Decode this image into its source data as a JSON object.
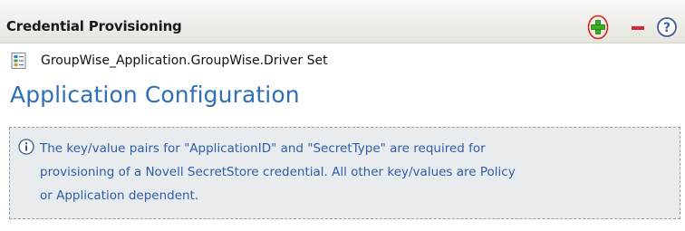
{
  "header": {
    "title": "Credential Provisioning",
    "icons": [
      "add-icon",
      "remove-icon",
      "help-icon"
    ],
    "accent_color": "#1f9a1f",
    "remove_color": "#d9263a",
    "highlight_color": "#e0201a"
  },
  "object": {
    "icon": "driver-set-icon",
    "label": "GroupWise_Application.GroupWise.Driver Set"
  },
  "section": {
    "title": "Application Configuration",
    "title_color": "#2f6fb6"
  },
  "info": {
    "icon": "info-icon",
    "lines": [
      "The key/value pairs for \"ApplicationID\" and \"SecretType\" are required for",
      "provisioning of a Novell SecretStore credential. All other key/values are Policy",
      "or Application dependent."
    ]
  }
}
